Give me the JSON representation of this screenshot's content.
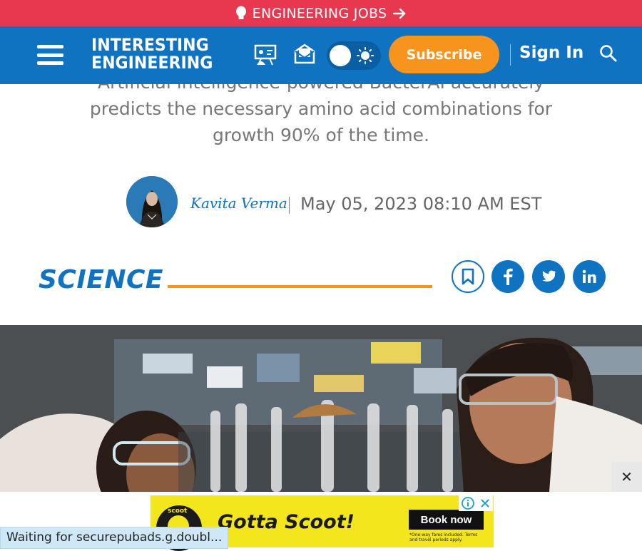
{
  "jobs_banner": {
    "label": "ENGINEERING JOBS"
  },
  "header": {
    "logo_line1": "INTERESTING",
    "logo_line2": "ENGINEERING",
    "subscribe_label": "Subscribe",
    "signin_label": "Sign In"
  },
  "article": {
    "subtitle_lines": [
      "Artificial intelligence-powered BacterAI accurately",
      "predicts the necessary amino acid combinations for",
      "growth 90% of the time."
    ],
    "author": "Kavita Verma",
    "date": "May 05, 2023 08:10 AM EST",
    "category": "SCIENCE"
  },
  "ad": {
    "headline": "Gotta Scoot!",
    "cta": "Book now",
    "fine_print": "*One-way fares included. Terms and travel periods apply.",
    "logo_text": "scoot"
  },
  "status_bar": {
    "text": "Waiting for securepubads.g.doubl..."
  },
  "colors": {
    "brand_blue": "#0f73c1",
    "jobs_red": "#e8384f",
    "subscribe_orange": "#f7941d",
    "ad_yellow": "#f3e61c"
  },
  "icons": {
    "jobs_bulb": "lightbulb-icon",
    "jobs_arrow": "arrow-right-icon",
    "menu": "hamburger-menu-icon",
    "events": "presentation-icon",
    "newsletter": "envelope-icon",
    "theme": "sun-icon",
    "search": "search-icon",
    "bookmark": "bookmark-icon",
    "facebook": "facebook-icon",
    "twitter": "twitter-icon",
    "linkedin": "linkedin-icon",
    "close": "close-icon"
  }
}
